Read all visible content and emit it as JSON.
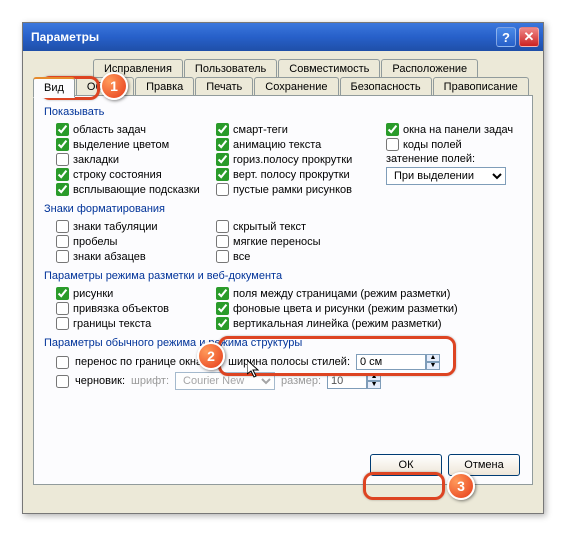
{
  "title": "Параметры",
  "tabs_row1": [
    "Исправления",
    "Пользователь",
    "Совместимость",
    "Расположение"
  ],
  "tabs_row2": [
    "Вид",
    "Общие",
    "Правка",
    "Печать",
    "Сохранение",
    "Безопасность",
    "Правописание"
  ],
  "groups": {
    "show": {
      "label": "Показывать",
      "col1": [
        {
          "label": "область задач",
          "checked": true
        },
        {
          "label": "выделение цветом",
          "checked": true
        },
        {
          "label": "закладки",
          "checked": false
        },
        {
          "label": "строку состояния",
          "checked": true
        },
        {
          "label": "всплывающие подсказки",
          "checked": true
        }
      ],
      "col2": [
        {
          "label": "смарт-теги",
          "checked": true
        },
        {
          "label": "анимацию текста",
          "checked": true
        },
        {
          "label": "гориз.полосу прокрутки",
          "checked": true
        },
        {
          "label": "верт. полосу прокрутки",
          "checked": true
        },
        {
          "label": "пустые рамки рисунков",
          "checked": false
        }
      ],
      "col3": [
        {
          "label": "окна на панели задач",
          "checked": true
        },
        {
          "label": "коды полей",
          "checked": false
        }
      ],
      "shadow_label": "затенение полей:",
      "shadow_value": "При выделении"
    },
    "fmt": {
      "label": "Знаки форматирования",
      "col1": [
        {
          "label": "знаки табуляции",
          "checked": false
        },
        {
          "label": "пробелы",
          "checked": false
        },
        {
          "label": "знаки абзацев",
          "checked": false
        }
      ],
      "col2": [
        {
          "label": "скрытый текст",
          "checked": false
        },
        {
          "label": "мягкие переносы",
          "checked": false
        },
        {
          "label": "все",
          "checked": false
        }
      ]
    },
    "layout": {
      "label": "Параметры режима разметки и веб-документа",
      "col1": [
        {
          "label": "рисунки",
          "checked": true
        },
        {
          "label": "привязка объектов",
          "checked": false
        },
        {
          "label": "границы текста",
          "checked": false
        }
      ],
      "col2": [
        {
          "label": "поля между страницами (режим разметки)",
          "checked": true
        },
        {
          "label": "фоновые цвета и рисунки (режим разметки)",
          "checked": true
        },
        {
          "label": "вертикальная линейка (режим разметки)",
          "checked": true
        }
      ]
    },
    "normal": {
      "label": "Параметры обычного режима и режима структуры",
      "wrap": {
        "label": "перенос по границе окна",
        "checked": false
      },
      "style_width_label": "ширина полосы стилей:",
      "style_width_value": "0 см",
      "draft": {
        "label": "черновик:",
        "checked": false
      },
      "font_label": "шрифт:",
      "font_value": "Courier New",
      "size_label": "размер:",
      "size_value": "10"
    }
  },
  "buttons": {
    "ok": "ОК",
    "cancel": "Отмена"
  },
  "badges": {
    "b1": "1",
    "b2": "2",
    "b3": "3"
  }
}
